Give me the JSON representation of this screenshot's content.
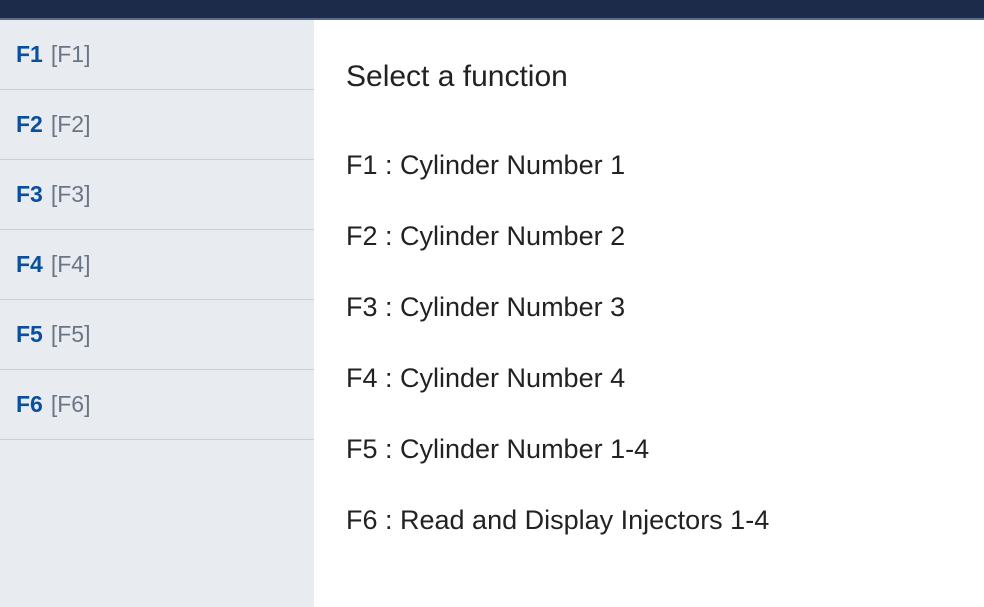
{
  "sidebar": {
    "items": [
      {
        "label": "F1",
        "bracket": "[F1]"
      },
      {
        "label": "F2",
        "bracket": "[F2]"
      },
      {
        "label": "F3",
        "bracket": "[F3]"
      },
      {
        "label": "F4",
        "bracket": "[F4]"
      },
      {
        "label": "F5",
        "bracket": "[F5]"
      },
      {
        "label": "F6",
        "bracket": "[F6]"
      }
    ]
  },
  "main": {
    "title": "Select a function",
    "functions": [
      "F1 : Cylinder Number 1",
      "F2 : Cylinder Number 2",
      "F3 : Cylinder Number 3",
      "F4 : Cylinder Number 4",
      "F5 : Cylinder Number 1-4",
      "F6 : Read and Display Injectors 1-4"
    ]
  }
}
